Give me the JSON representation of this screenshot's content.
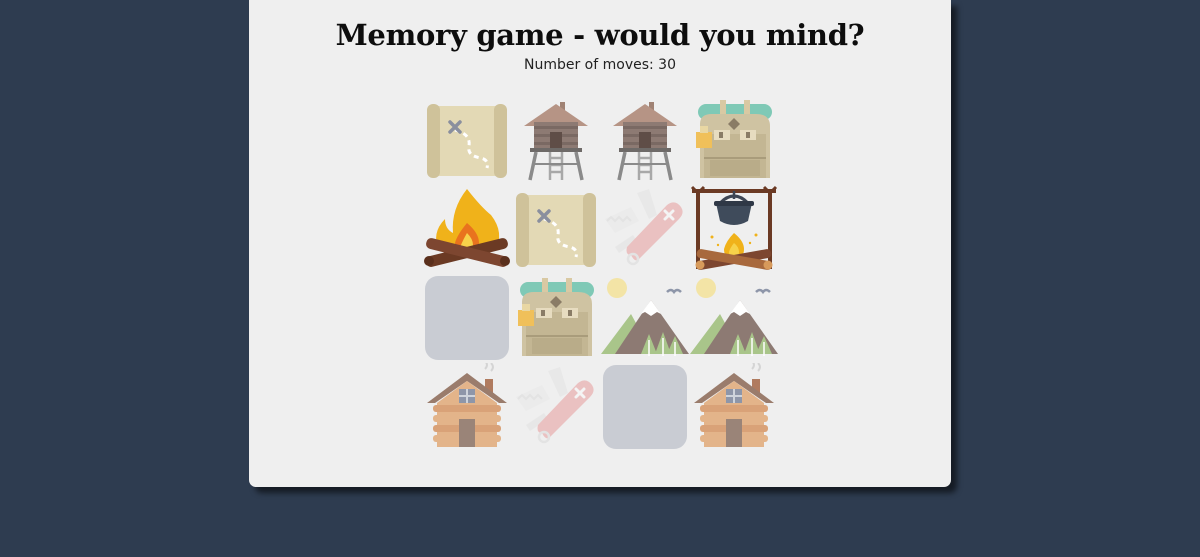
{
  "game": {
    "title": "Memory game - would you mind?",
    "moves_label": "Number of moves:",
    "moves_count": 30,
    "moves_text": "Number of moves: 30"
  },
  "colors": {
    "page_background": "#2e3c50",
    "panel_background": "#efefef",
    "card_back": "#c9ccd3"
  },
  "board": {
    "rows": 4,
    "columns": 4,
    "cards": [
      {
        "icon": "treasure-map-icon",
        "state": "face-up"
      },
      {
        "icon": "watchtower-icon",
        "state": "face-up"
      },
      {
        "icon": "watchtower-icon",
        "state": "face-up"
      },
      {
        "icon": "backpack-icon",
        "state": "face-up"
      },
      {
        "icon": "campfire-icon",
        "state": "face-up"
      },
      {
        "icon": "treasure-map-icon",
        "state": "face-up"
      },
      {
        "icon": "pocket-knife-icon",
        "state": "face-up-matched"
      },
      {
        "icon": "cooking-pot-fire-icon",
        "state": "face-up"
      },
      {
        "icon": "card-back",
        "state": "face-down"
      },
      {
        "icon": "backpack-icon",
        "state": "face-up"
      },
      {
        "icon": "mountains-icon",
        "state": "face-up"
      },
      {
        "icon": "mountains-icon",
        "state": "face-up"
      },
      {
        "icon": "log-cabin-icon",
        "state": "face-up"
      },
      {
        "icon": "pocket-knife-icon",
        "state": "face-up-matched"
      },
      {
        "icon": "card-back",
        "state": "face-down"
      },
      {
        "icon": "log-cabin-icon",
        "state": "face-up"
      }
    ]
  }
}
